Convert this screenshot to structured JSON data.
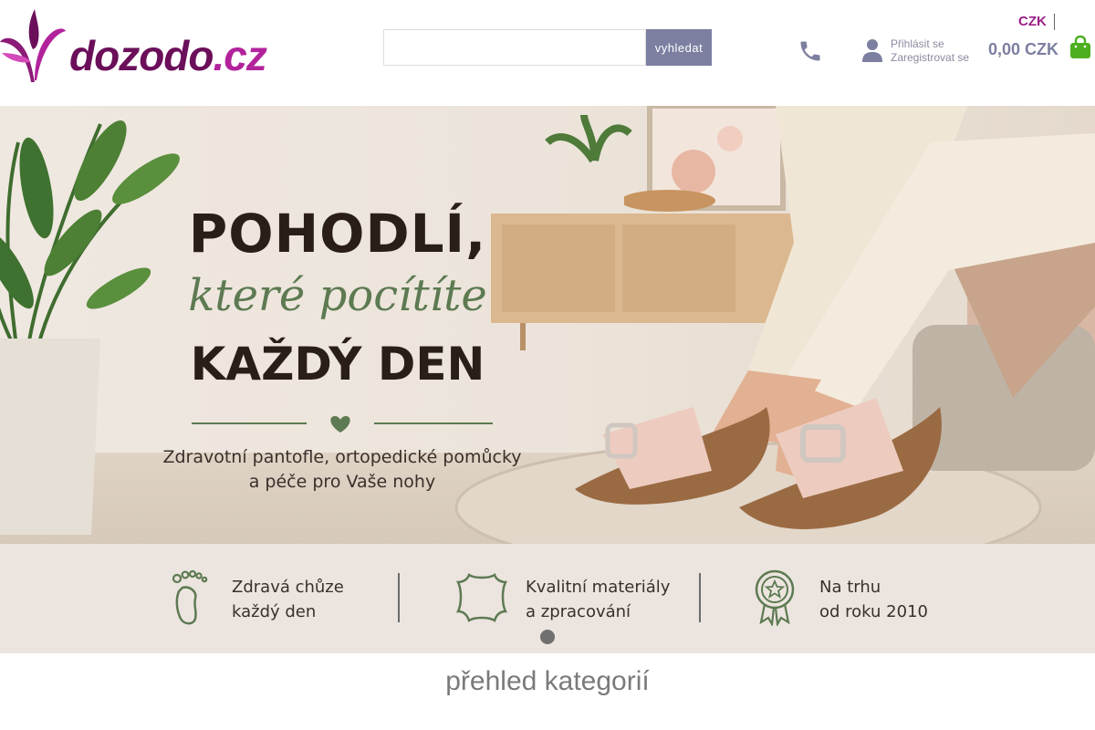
{
  "brand": {
    "name": "dozodo",
    "tld": ".cz",
    "primary_color": "#6b0f5a",
    "accent_color": "#b2239b"
  },
  "search": {
    "placeholder": "",
    "value": "",
    "button_label": "vyhledat"
  },
  "header": {
    "phone_icon": "phone-icon",
    "user_icon": "user-icon",
    "login_label": "Přihlásit se",
    "register_label": "Zaregistrovat se",
    "currency_label": "CZK",
    "cart_total": "0,00 CZK",
    "cart_icon": "shopping-bag-icon",
    "cart_color": "#4caf1f"
  },
  "hero": {
    "headline_line1": "POHODLÍ,",
    "headline_line2": "které pocítíte",
    "headline_line3": "KAŽDÝ DEN",
    "subtitle_line1": "Zdravotní pantofle, ortopedické pomůcky",
    "subtitle_line2": "a péče pro Vaše nohy",
    "features": [
      {
        "icon": "foot-icon",
        "line1": "Zdravá chůze",
        "line2": "každý den"
      },
      {
        "icon": "leather-icon",
        "line1": "Kvalitní materiály",
        "line2": "a zpracování"
      },
      {
        "icon": "award-badge-icon",
        "line1": "Na trhu",
        "line2": "od roku 2010"
      }
    ],
    "slide_count": 1,
    "active_slide": 1
  },
  "categories": {
    "title": "přehled kategorií"
  }
}
